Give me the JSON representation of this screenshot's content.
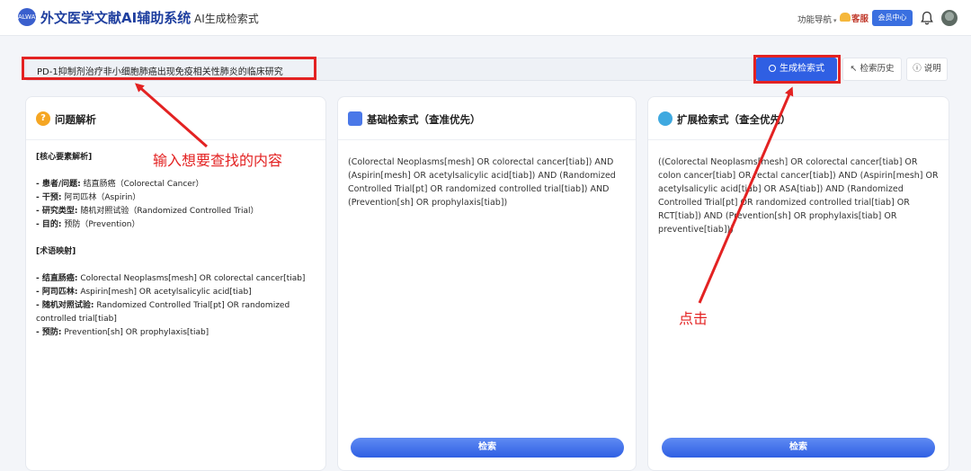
{
  "header": {
    "logo_text": "ALWAYS",
    "brand": "外文医学文献AI辅助系统",
    "subtitle": "AI生成检索式",
    "nav_func": "功能导航",
    "service": "客服",
    "member": "会员中心"
  },
  "search": {
    "value": "PD-1抑制剂治疗非小细胞肺癌出现免疫相关性肺炎的临床研究",
    "generate_label": "生成检索式",
    "history_label": "检索历史",
    "help_label": "说明"
  },
  "panels": {
    "analysis": {
      "title": "问题解析",
      "sec1": "[核心要素解析]",
      "items1": [
        {
          "k": "- 患者/问题:",
          "v": " 结直肠癌（Colorectal Cancer）"
        },
        {
          "k": "- 干预:",
          "v": " 阿司匹林（Aspirin）"
        },
        {
          "k": "- 研究类型:",
          "v": " 随机对照试验（Randomized Controlled Trial）"
        },
        {
          "k": "- 目的:",
          "v": " 预防（Prevention）"
        }
      ],
      "sec2": "[术语映射]",
      "items2": [
        {
          "k": "- 结直肠癌:",
          "v": " Colorectal Neoplasms[mesh] OR colorectal cancer[tiab]"
        },
        {
          "k": "- 阿司匹林:",
          "v": " Aspirin[mesh] OR acetylsalicylic acid[tiab]"
        },
        {
          "k": "- 随机对照试验:",
          "v": " Randomized Controlled Trial[pt] OR randomized controlled trial[tiab]"
        },
        {
          "k": "- 预防:",
          "v": " Prevention[sh] OR prophylaxis[tiab]"
        }
      ]
    },
    "basic": {
      "title": "基础检索式（查准优先）",
      "query": "(Colorectal Neoplasms[mesh] OR colorectal cancer[tiab]) AND (Aspirin[mesh] OR acetylsalicylic acid[tiab]) AND (Randomized Controlled Trial[pt] OR randomized controlled trial[tiab]) AND (Prevention[sh] OR prophylaxis[tiab])",
      "button": "检索"
    },
    "extended": {
      "title": "扩展检索式（查全优先）",
      "query": "((Colorectal Neoplasms[mesh] OR colorectal cancer[tiab] OR colon cancer[tiab] OR rectal cancer[tiab]) AND (Aspirin[mesh] OR acetylsalicylic acid[tiab] OR ASA[tiab]) AND (Randomized Controlled Trial[pt] OR randomized controlled trial[tiab] OR RCT[tiab]) AND (Prevention[sh] OR prophylaxis[tiab] OR preventive[tiab]))",
      "button": "检索"
    }
  },
  "annotations": {
    "input_hint": "输入想要查找的内容",
    "click_hint": "点击"
  },
  "colors": {
    "primary": "#2f5fe3",
    "highlight": "#e32222",
    "brand": "#1f3f9f"
  }
}
